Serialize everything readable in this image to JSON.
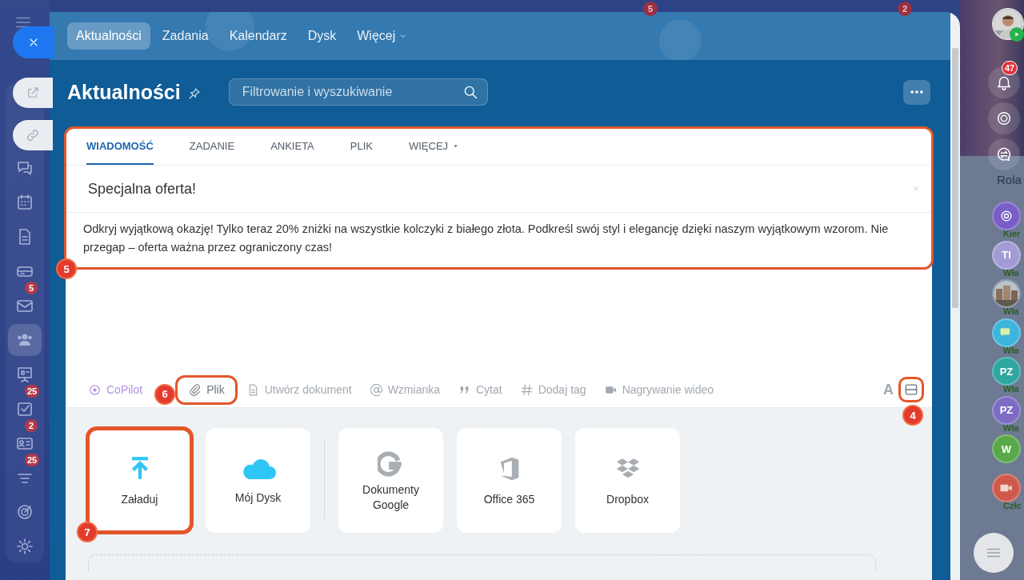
{
  "background_badges": [
    {
      "text": "5"
    },
    {
      "text": "2"
    }
  ],
  "left_sidebar": {
    "items": [
      {
        "selected": false
      },
      {
        "selected": false
      },
      {
        "selected": false
      },
      {
        "selected": false
      },
      {
        "selected": false,
        "badge": "5"
      },
      {
        "selected": true
      },
      {
        "selected": false
      },
      {
        "selected": false,
        "badge": "25"
      },
      {
        "selected": false,
        "badge": "2"
      },
      {
        "selected": false,
        "badge": "25"
      },
      {
        "selected": false
      },
      {
        "selected": false
      }
    ]
  },
  "nav_tabs": [
    {
      "label": "Aktualności",
      "selected": true,
      "kind": "link"
    },
    {
      "label": "Zadania",
      "selected": false,
      "kind": "link"
    },
    {
      "label": "Kalendarz",
      "selected": false,
      "kind": "link"
    },
    {
      "label": "Dysk",
      "selected": false,
      "kind": "link"
    },
    {
      "label": "Więcej",
      "selected": false,
      "kind": "dropdown"
    }
  ],
  "page_title": "Aktualności",
  "search": {
    "placeholder": "Filtrowanie i wyszukiwanie"
  },
  "editor": {
    "callout": "5",
    "tabs": [
      {
        "label": "WIADOMOŚĆ",
        "selected": true,
        "kind": "link"
      },
      {
        "label": "ZADANIE",
        "selected": false,
        "kind": "link"
      },
      {
        "label": "ANKIETA",
        "selected": false,
        "kind": "link"
      },
      {
        "label": "PLIK",
        "selected": false,
        "kind": "link"
      },
      {
        "label": "WIĘCEJ",
        "selected": false,
        "kind": "dropdown"
      }
    ],
    "title": "Specjalna oferta!",
    "body": "Odkryj wyjątkową okazję! Tylko teraz 20% zniżki na wszystkie kolczyki z białego złota. Podkreśl swój styl i elegancję dzięki naszym wyjątkowym wzorom. Nie przegap – oferta ważna przez ograniczony czas!",
    "toolbar": [
      {
        "label": "CoPilot",
        "kind": "ai"
      },
      {
        "label": "Plik",
        "kind": "tool",
        "callout": "6"
      },
      {
        "label": "Utwórz dokument",
        "kind": "tool"
      },
      {
        "label": "Wzmianka",
        "kind": "tool"
      },
      {
        "label": "Cytat",
        "kind": "tool"
      },
      {
        "label": "Dodaj tag",
        "kind": "tool"
      },
      {
        "label": "Nagrywanie wideo",
        "kind": "tool"
      }
    ],
    "format_button": "A",
    "panel_button": {
      "callout": "4"
    },
    "file_sources": [
      {
        "label": "Załaduj",
        "kind": "local",
        "callout": "7"
      },
      {
        "label": "Mój Dysk",
        "kind": "local"
      },
      {
        "label": "Dokumenty Google",
        "kind": "cloud"
      },
      {
        "label": "Office 365",
        "kind": "cloud"
      },
      {
        "label": "Dropbox",
        "kind": "cloud"
      }
    ]
  },
  "right_sidebar": {
    "notifications_badge": "47",
    "role_label": "Rola",
    "rows": [
      {
        "kind": "icon",
        "color": "#7a5ec8",
        "label": "Kier"
      },
      {
        "kind": "initials",
        "text": "TI",
        "color": "#a39bd6",
        "label": "Wła"
      },
      {
        "kind": "picture",
        "label": "Wła"
      },
      {
        "kind": "chat",
        "color": "#3fb4dc",
        "label": "Wła"
      },
      {
        "kind": "initials",
        "text": "PZ",
        "color": "#2fa6a0",
        "label": "Wła"
      },
      {
        "kind": "initials",
        "text": "PZ",
        "color": "#7d6cc4",
        "label": "Wła"
      },
      {
        "kind": "initials",
        "text": "W",
        "color": "#5aa84a"
      },
      {
        "kind": "video",
        "color": "#cf5a4c",
        "label": "Człc"
      }
    ]
  }
}
